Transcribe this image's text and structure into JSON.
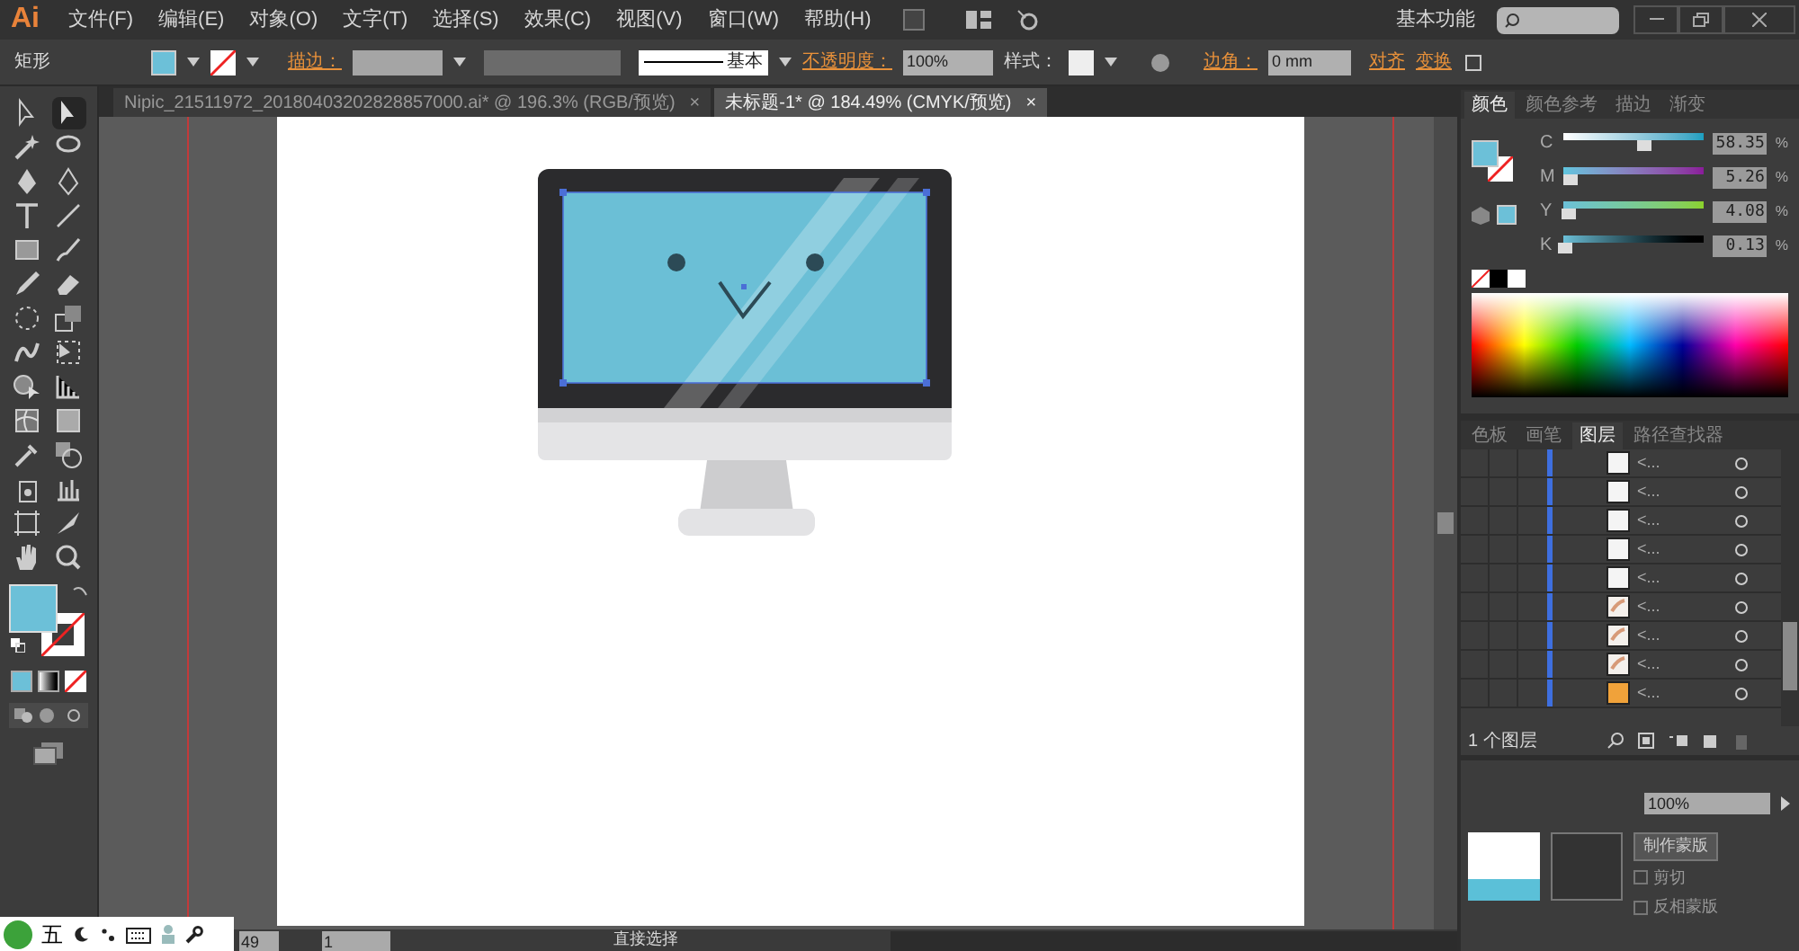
{
  "app_logo": "Ai",
  "menu": [
    "文件(F)",
    "编辑(E)",
    "对象(O)",
    "文字(T)",
    "选择(S)",
    "效果(C)",
    "视图(V)",
    "窗口(W)",
    "帮助(H)"
  ],
  "workspace": "基本功能",
  "control_bar": {
    "object_type": "矩形",
    "stroke_label": "描边：",
    "stroke_style": "基本",
    "opacity_label": "不透明度：",
    "opacity": "100%",
    "style_label": "样式：",
    "corner_label": "边角：",
    "corner_value": "0 mm",
    "align": "对齐",
    "transform": "变换"
  },
  "doc_tabs": [
    {
      "title": "Nipic_21511972_20180403202828857000.ai* @ 196.3% (RGB/预览)",
      "close": "×",
      "selected": false
    },
    {
      "title": "未标题-1* @ 184.49% (CMYK/预览)",
      "close": "×",
      "selected": true
    }
  ],
  "tools": [
    {
      "kind": "select",
      "selected": false
    },
    {
      "kind": "direct",
      "selected": true
    },
    {
      "kind": "wand",
      "selected": false
    },
    {
      "kind": "lasso",
      "selected": false
    },
    {
      "kind": "pen",
      "selected": false
    },
    {
      "kind": "curvature",
      "selected": false
    },
    {
      "kind": "type",
      "selected": false
    },
    {
      "kind": "line",
      "selected": false
    },
    {
      "kind": "rect",
      "selected": false
    },
    {
      "kind": "brush",
      "selected": false
    },
    {
      "kind": "pencil",
      "selected": false
    },
    {
      "kind": "eraser",
      "selected": false
    },
    {
      "kind": "rotate",
      "selected": false
    },
    {
      "kind": "scale",
      "selected": false
    },
    {
      "kind": "warp",
      "selected": false
    },
    {
      "kind": "freetransform",
      "selected": false
    },
    {
      "kind": "shapebuilder",
      "selected": false
    },
    {
      "kind": "perspective",
      "selected": false
    },
    {
      "kind": "mesh",
      "selected": false
    },
    {
      "kind": "gradient",
      "selected": false
    },
    {
      "kind": "eyedropper",
      "selected": false
    },
    {
      "kind": "blend",
      "selected": false
    },
    {
      "kind": "symbol",
      "selected": false
    },
    {
      "kind": "graph",
      "selected": false
    },
    {
      "kind": "artboard",
      "selected": false
    },
    {
      "kind": "slice",
      "selected": false
    },
    {
      "kind": "hand",
      "selected": false
    },
    {
      "kind": "zoom",
      "selected": false
    }
  ],
  "color_panel": {
    "tabs": [
      {
        "label": "颜色",
        "selected": true
      },
      {
        "label": "颜色参考",
        "selected": false
      },
      {
        "label": "描边",
        "selected": false
      },
      {
        "label": "渐变",
        "selected": false
      }
    ],
    "sliders": [
      {
        "label": "C",
        "level": 0.58,
        "value": "58.35",
        "unit": "%"
      },
      {
        "label": "M",
        "level": 0.05,
        "value": "5.26",
        "unit": "%"
      },
      {
        "label": "Y",
        "level": 0.04,
        "value": "4.08",
        "unit": "%"
      },
      {
        "label": "K",
        "level": 0.01,
        "value": "0.13",
        "unit": "%"
      }
    ]
  },
  "layers_panel": {
    "tabs": [
      {
        "label": "色板",
        "selected": false
      },
      {
        "label": "画笔",
        "selected": false
      },
      {
        "label": "图层",
        "selected": true
      },
      {
        "label": "路径查找器",
        "selected": false
      }
    ],
    "rows": [
      {
        "name": "<...",
        "kind": "blank"
      },
      {
        "name": "<...",
        "kind": "blank"
      },
      {
        "name": "<...",
        "kind": "blank"
      },
      {
        "name": "<...",
        "kind": "blank"
      },
      {
        "name": "<...",
        "kind": "blank"
      },
      {
        "name": "<...",
        "kind": "sketch"
      },
      {
        "name": "<...",
        "kind": "sketch"
      },
      {
        "name": "<...",
        "kind": "sketch"
      },
      {
        "name": "<...",
        "kind": "orange"
      }
    ],
    "count": "1 个图层"
  },
  "transparency_panel": {
    "opacity": "100%",
    "make_mask": "制作蒙版",
    "clip": "剪切",
    "clip_checked": false,
    "invert_mask": "反相蒙版",
    "invert_checked": false
  },
  "status_bar": {
    "zoom": "49",
    "page": "1",
    "tool": "直接选择"
  },
  "ime_bar": {
    "mode": "五"
  }
}
